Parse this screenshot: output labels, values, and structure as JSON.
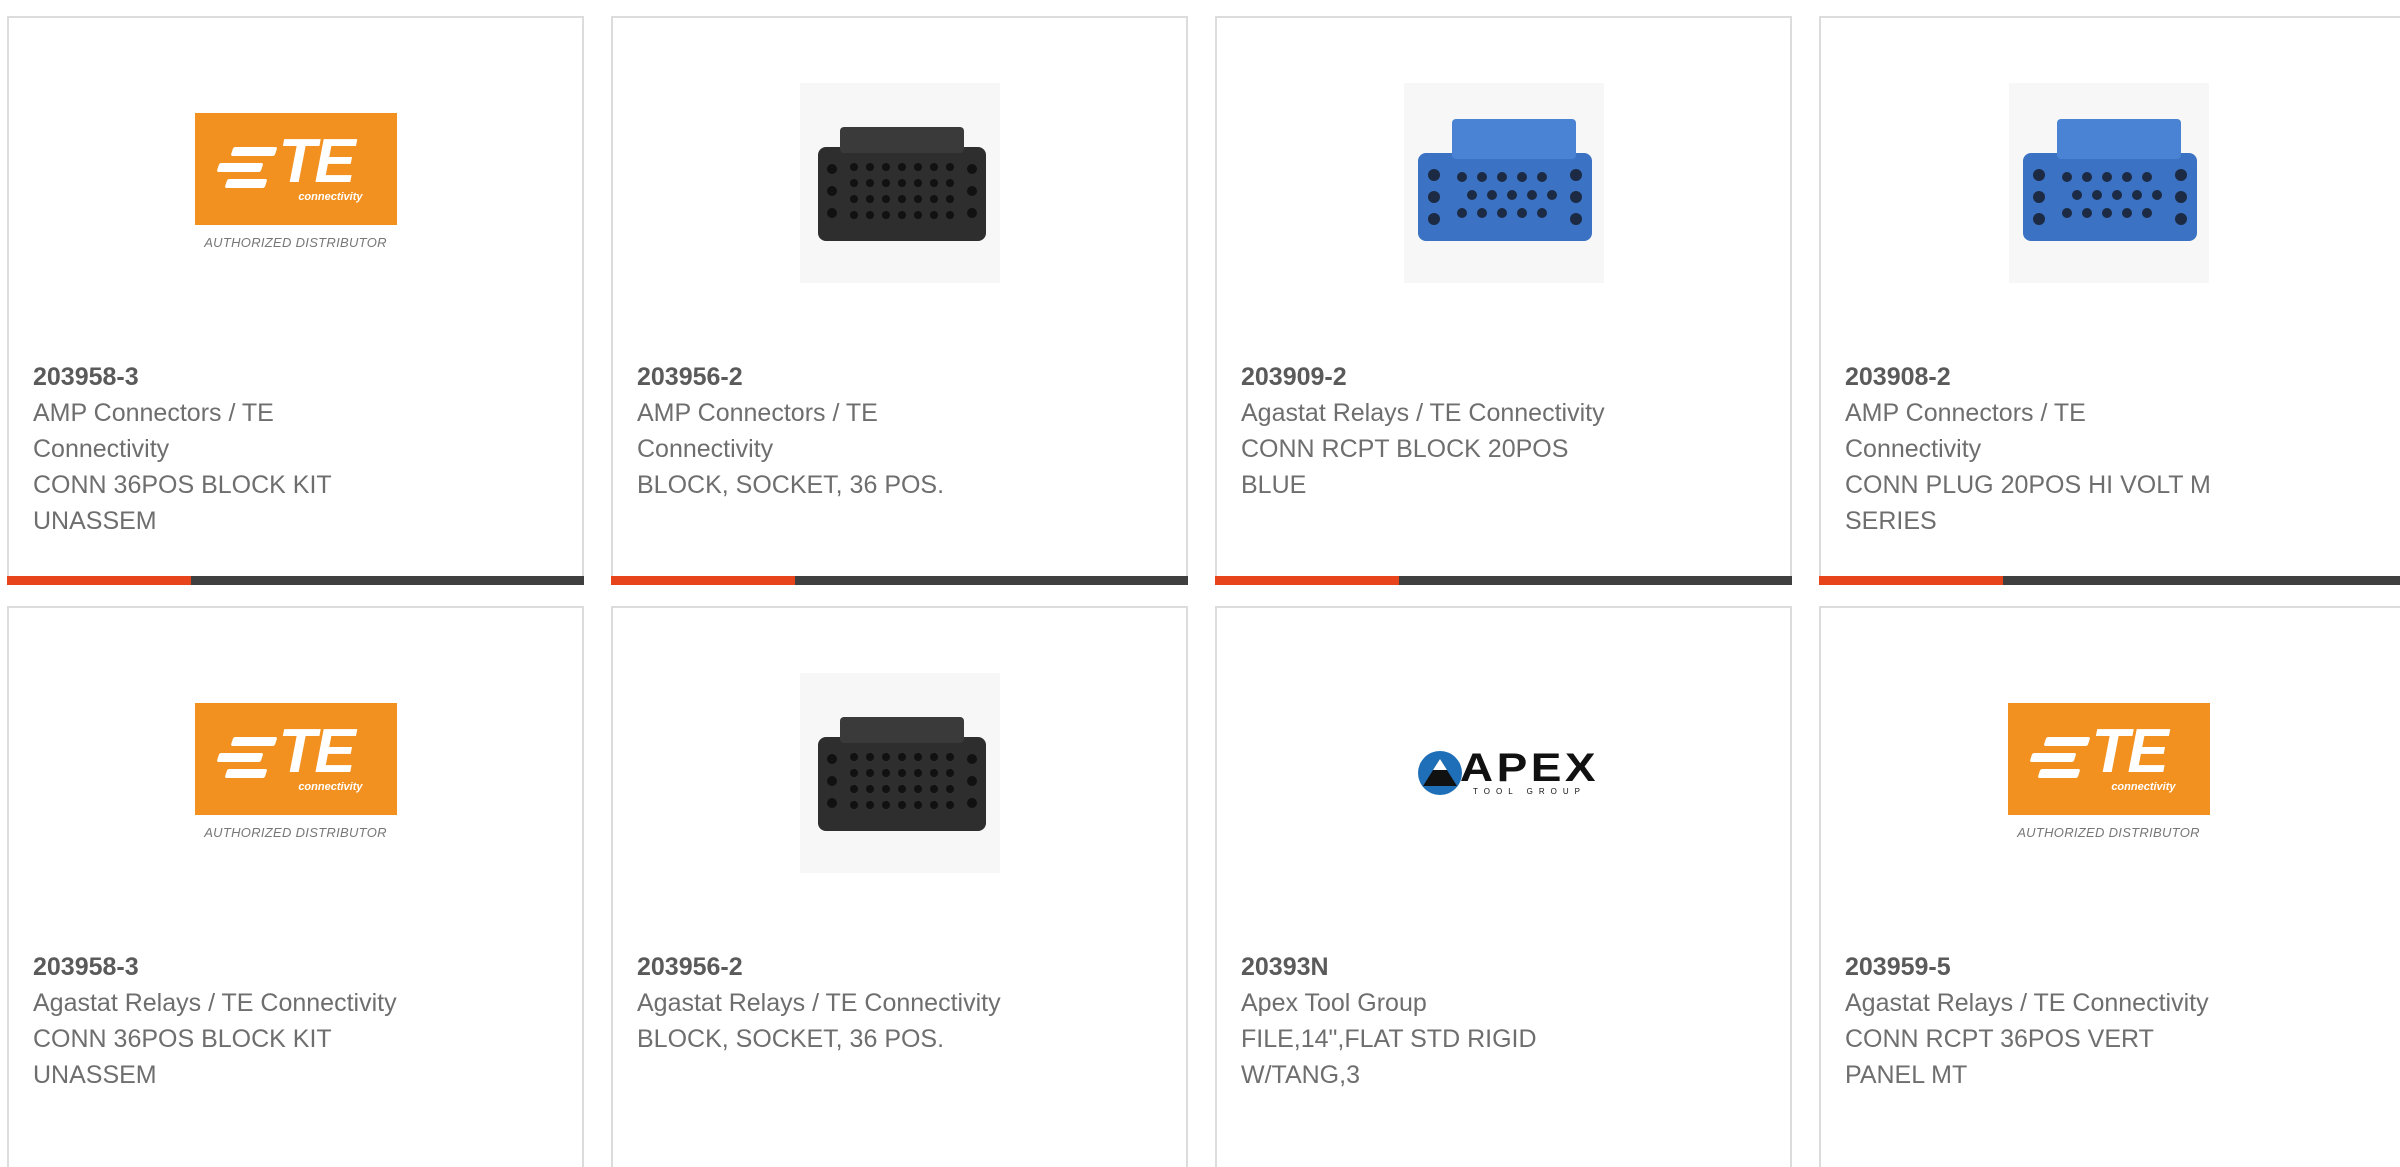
{
  "cards": [
    {
      "part_number": "203958-3",
      "manufacturer_line1": "AMP Connectors / TE",
      "manufacturer_line2": "Connectivity",
      "desc_line1": "CONN 36POS BLOCK KIT",
      "desc_line2": "UNASSEM",
      "image": "te-connectivity-logo"
    },
    {
      "part_number": "203956-2",
      "manufacturer_line1": "AMP Connectors / TE",
      "manufacturer_line2": "Connectivity",
      "desc_line1": "BLOCK, SOCKET, 36 POS.",
      "desc_line2": "",
      "image": "black-connector-block"
    },
    {
      "part_number": "203909-2",
      "manufacturer_line1": "Agastat Relays / TE Connectivity",
      "manufacturer_line2": "",
      "desc_line1": "CONN RCPT BLOCK 20POS",
      "desc_line2": "BLUE",
      "image": "blue-connector-block"
    },
    {
      "part_number": "203908-2",
      "manufacturer_line1": "AMP Connectors / TE",
      "manufacturer_line2": "Connectivity",
      "desc_line1": "CONN PLUG 20POS HI VOLT M",
      "desc_line2": "SERIES",
      "image": "blue-connector-block"
    },
    {
      "part_number": "203958-3",
      "manufacturer_line1": "Agastat Relays / TE Connectivity",
      "manufacturer_line2": "",
      "desc_line1": "CONN 36POS BLOCK KIT",
      "desc_line2": "UNASSEM",
      "image": "te-connectivity-logo"
    },
    {
      "part_number": "203956-2",
      "manufacturer_line1": "Agastat Relays / TE Connectivity",
      "manufacturer_line2": "",
      "desc_line1": "BLOCK, SOCKET, 36 POS.",
      "desc_line2": "",
      "image": "black-connector-block"
    },
    {
      "part_number": "20393N",
      "manufacturer_line1": "Apex Tool Group",
      "manufacturer_line2": "",
      "desc_line1": "FILE,14\",FLAT STD RIGID",
      "desc_line2": "W/TANG,3",
      "image": "apex-tool-group-logo"
    },
    {
      "part_number": "203959-5",
      "manufacturer_line1": "Agastat Relays / TE Connectivity",
      "manufacturer_line2": "",
      "desc_line1": "CONN RCPT 36POS VERT",
      "desc_line2": "PANEL MT",
      "image": "te-connectivity-logo"
    }
  ],
  "logos": {
    "te": {
      "wordmark": "TE",
      "subtext": "connectivity",
      "caption": "AUTHORIZED DISTRIBUTOR"
    },
    "apex": {
      "wordmark": "APEX",
      "subtext": "TOOL GROUP"
    }
  },
  "colors": {
    "accent": "#e8441c",
    "bar": "#3f3f3f",
    "te_orange": "#f39120",
    "blue_connector": "#3b72c4",
    "black_connector": "#2e2e2e"
  }
}
